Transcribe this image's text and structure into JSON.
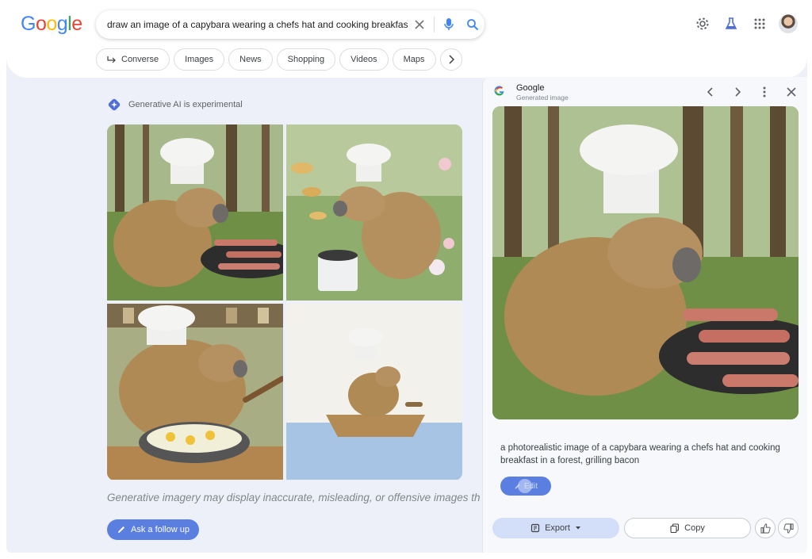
{
  "header": {
    "logo_letters": [
      {
        "ch": "G",
        "color": "#4285F4"
      },
      {
        "ch": "o",
        "color": "#EA4335"
      },
      {
        "ch": "o",
        "color": "#FBBC05"
      },
      {
        "ch": "g",
        "color": "#4285F4"
      },
      {
        "ch": "l",
        "color": "#34A853"
      },
      {
        "ch": "e",
        "color": "#EA4335"
      }
    ],
    "search_query": "draw an image of a capybara wearing a chefs hat and cooking breakfast",
    "icons": [
      "close-icon",
      "mic-icon",
      "search-icon",
      "settings-icon",
      "labs-flask-icon",
      "apps-grid-icon",
      "avatar"
    ]
  },
  "filters": {
    "chips": [
      "Converse",
      "Images",
      "News",
      "Shopping",
      "Videos",
      "Maps"
    ],
    "more_icon": "chevron-right-icon"
  },
  "main": {
    "genai_label": "Generative AI is experimental",
    "disclaimer": "Generative imagery may display inaccurate, misleading, or offensive images that do",
    "follow_up_label": "Ask a follow up",
    "image_descriptions": [
      "capybara chef grilling bacon in forest",
      "capybara chef cooking pancakes in meadow",
      "capybara chef frying eggs in kitchen",
      "capybara chef in boat on water"
    ]
  },
  "panel": {
    "source_title": "Google",
    "source_subtitle": "Generated image",
    "caption": "a photorealistic image of a capybara wearing a chefs hat and cooking breakfast in a forest, grilling bacon",
    "edit_label": "Edit",
    "export_label": "Export",
    "copy_label": "Copy",
    "nav_icons": [
      "chevron-left-icon",
      "chevron-right-icon",
      "more-vert-icon",
      "close-icon"
    ]
  },
  "colors": {
    "accent": "#5b7fe0",
    "panel_bg": "#f6f8fc",
    "page_bg": "#edf0f8"
  }
}
